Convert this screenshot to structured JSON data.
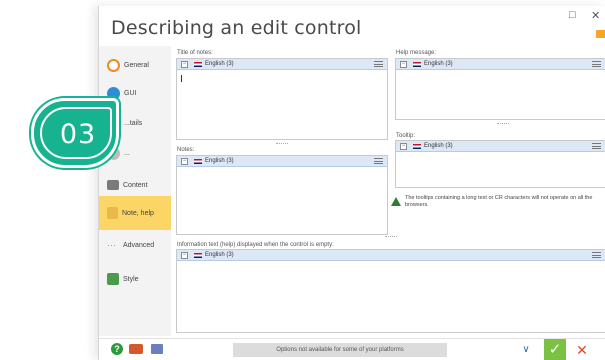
{
  "window": {
    "title": "Describing an edit control",
    "controls": {
      "minimize": "□",
      "close": "✕"
    }
  },
  "sidebar": {
    "items": [
      {
        "label": "General",
        "icon": "ring-icon"
      },
      {
        "label": "GUI",
        "icon": "eye-icon"
      },
      {
        "label": "...tails",
        "icon": "details-icon"
      },
      {
        "label": "...",
        "icon": "data-icon"
      },
      {
        "label": "Content",
        "icon": "folder-icon"
      },
      {
        "label": "Note, help",
        "icon": "note-icon",
        "active": true
      },
      {
        "label": "Advanced",
        "icon": "dots-icon"
      },
      {
        "label": "Style",
        "icon": "style-icon"
      }
    ]
  },
  "panels": {
    "title_of_notes": {
      "label": "Title of notes:",
      "lang": "English (3)"
    },
    "notes": {
      "label": "Notes:",
      "lang": "English (3)"
    },
    "help_message": {
      "label": "Help message:",
      "lang": "English (3)"
    },
    "tooltip": {
      "label": "Tooltip:",
      "lang": "English (3)"
    },
    "tooltip_warning": "The tooltips containing a long text or CR characters will not operate on all the browsers.",
    "info_text": {
      "label": "Information text (help) displayed when the control is empty:",
      "lang": "English (3)"
    }
  },
  "bottombar": {
    "help": "?",
    "platform_message": "Options not available for some of your platforms",
    "chevron": "∨",
    "ok": "✓",
    "cancel": "✕"
  },
  "badge": {
    "number": "03"
  },
  "colors": {
    "badge": "#17b390",
    "active_tab": "#fbd565",
    "lang_bar": "#dde8f7",
    "ok_button": "#7cc242",
    "cancel_button": "#e0492c"
  }
}
